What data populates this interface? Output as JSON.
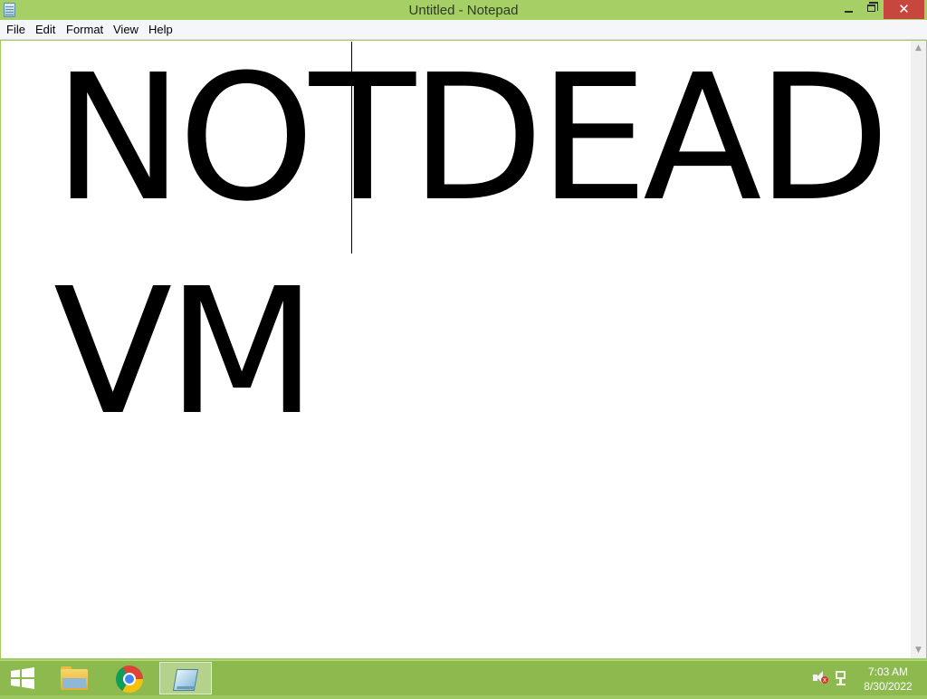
{
  "window": {
    "title": "Untitled - Notepad",
    "close_glyph": "✕"
  },
  "menu": {
    "file": "File",
    "edit": "Edit",
    "format": "Format",
    "view": "View",
    "help": "Help"
  },
  "editor": {
    "lines": [
      "NOTDEAD",
      "VM"
    ]
  },
  "scrollbar": {
    "up_glyph": "▲",
    "down_glyph": "▼"
  },
  "taskbar": {
    "apps": [
      "File Explorer",
      "Google Chrome",
      "Notepad"
    ],
    "active_app": "Notepad",
    "volume_state": "muted"
  },
  "clock": {
    "time": "7:03 AM",
    "date": "8/30/2022"
  },
  "colors": {
    "accent": "#a6d065",
    "taskbar": "#8cba4f",
    "close_button": "#c7463d"
  }
}
